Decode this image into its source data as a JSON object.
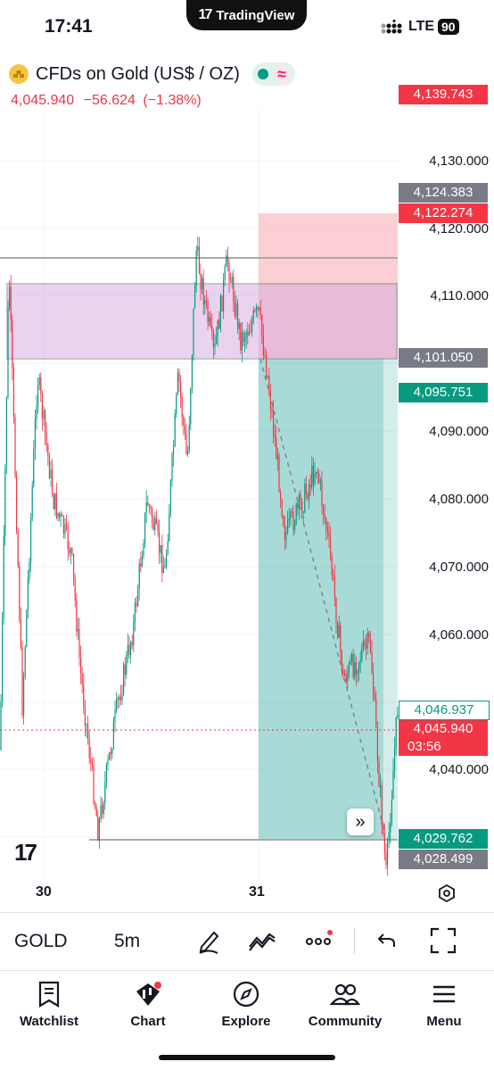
{
  "status_bar": {
    "time": "17:41",
    "app_pill": "TradingView",
    "network": "LTE",
    "battery": "90"
  },
  "header": {
    "symbol_title": "CFDs on Gold (US$ / OZ)",
    "last_price": "4,045.940",
    "change": "−56.624",
    "change_pct": "(−1.38%)"
  },
  "colors": {
    "up": "#089981",
    "down": "#f23645",
    "text": "#131722",
    "box": "#e1bee7",
    "target": "#26a69a",
    "stop": "#f7a8ae"
  },
  "chart": {
    "y_labels": [
      "4,130.000",
      "4,120.000",
      "4,110.000",
      "4,090.000",
      "4,080.000",
      "4,070.000",
      "4,060.000",
      "4,040.000"
    ],
    "tags": {
      "top": "4,139.743",
      "t1": "4,124.383",
      "t2": "4,122.274",
      "entry": "4,101.050",
      "t3": "4,095.751",
      "t4": "4,046.937",
      "current": "4,045.940",
      "countdown": "03:56",
      "t5": "4,029.762",
      "t6": "4,028.499"
    },
    "x_labels": [
      "30",
      "31"
    ]
  },
  "toolbar": {
    "symbol": "GOLD",
    "interval": "5m"
  },
  "nav": {
    "watchlist": "Watchlist",
    "chart": "Chart",
    "explore": "Explore",
    "community": "Community",
    "menu": "Menu"
  }
}
